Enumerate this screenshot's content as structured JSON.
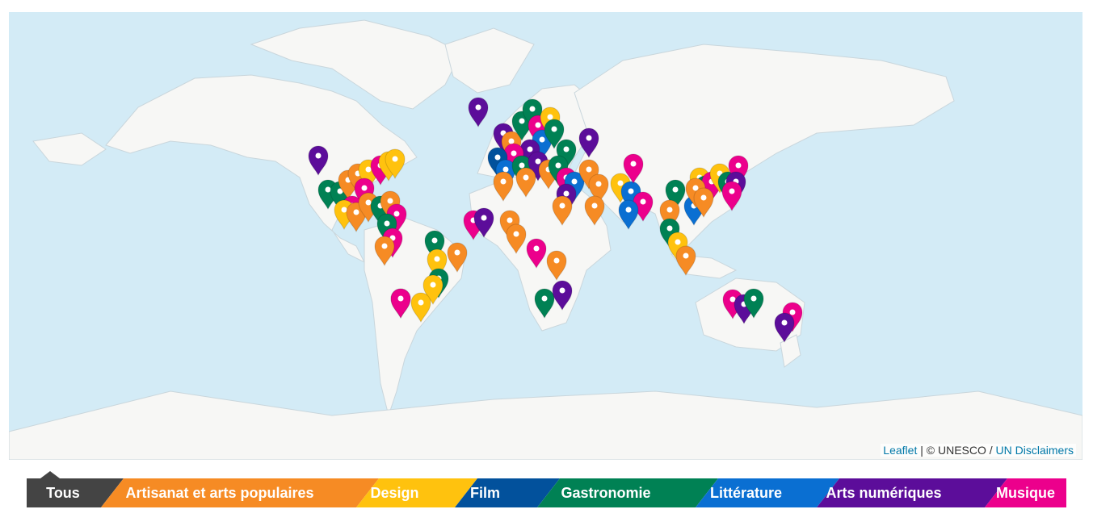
{
  "attribution": {
    "leaflet": "Leaflet",
    "sep": " | © ",
    "org": "UNESCO",
    "slash": " / ",
    "disclaimer": "UN Disclaimers"
  },
  "filters": [
    {
      "label": "Tous",
      "color": "#444444",
      "active": true
    },
    {
      "label": "Artisanat et arts populaires",
      "color": "#f68b24"
    },
    {
      "label": "Design",
      "color": "#ffc20e"
    },
    {
      "label": "Film",
      "color": "#02519c"
    },
    {
      "label": "Gastronomie",
      "color": "#008154"
    },
    {
      "label": "Littérature",
      "color": "#0a6fd2"
    },
    {
      "label": "Arts numériques",
      "color": "#5c0d9a"
    },
    {
      "label": "Musique",
      "color": "#ec008c"
    }
  ],
  "marker_categories": [
    "artisanat",
    "design",
    "film",
    "gastronomie",
    "litterature",
    "arts-numeriques",
    "musique"
  ]
}
